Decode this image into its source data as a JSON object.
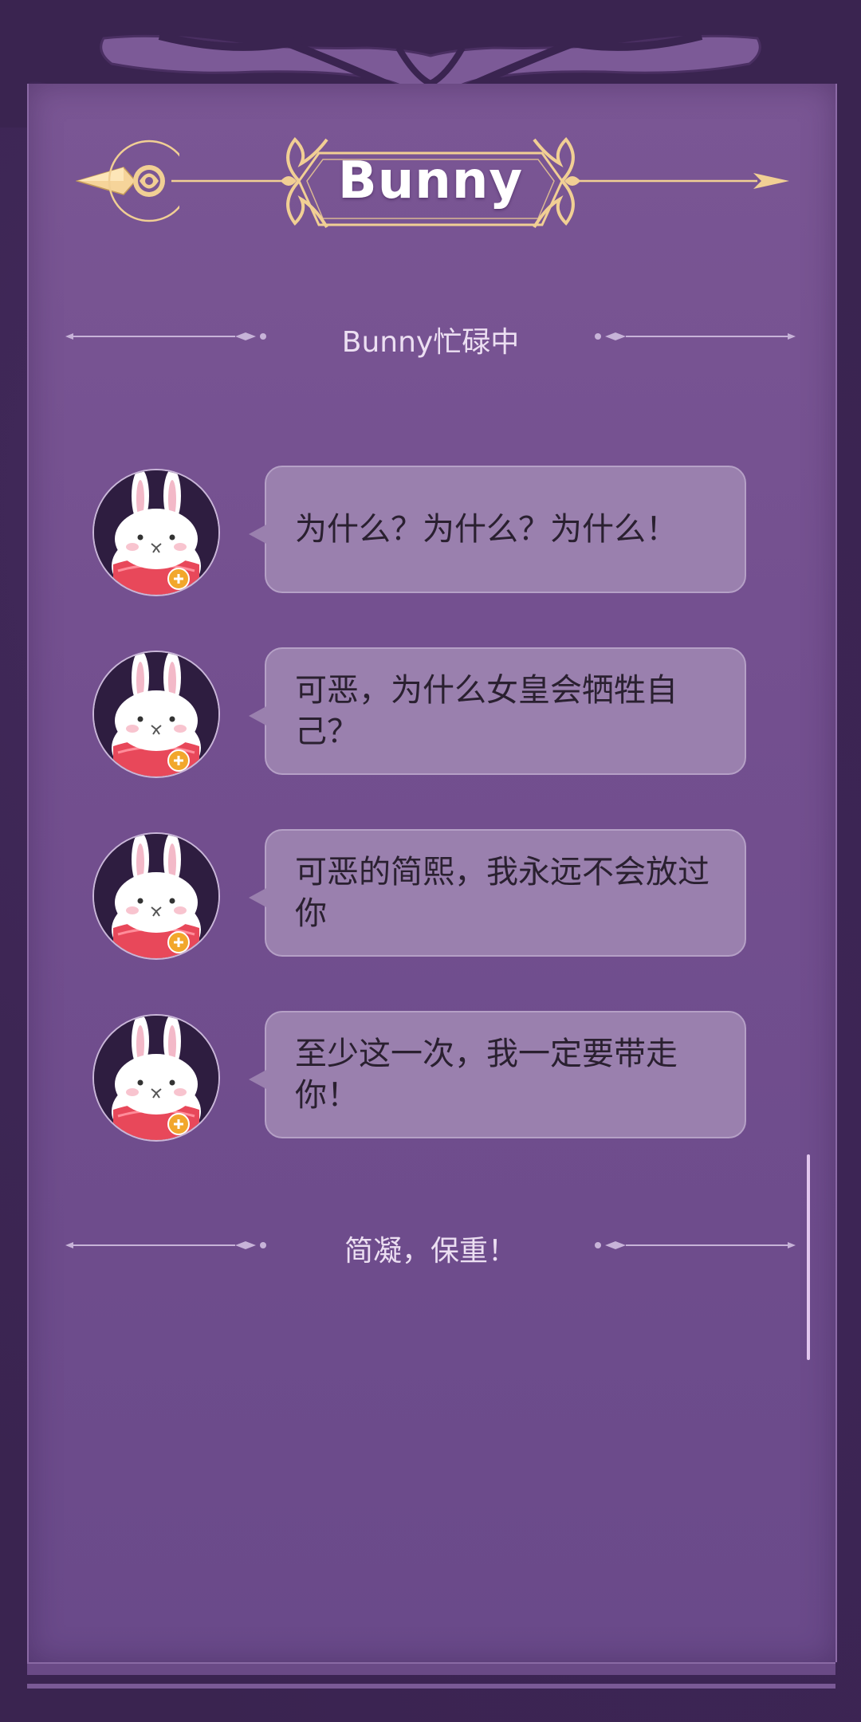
{
  "header": {
    "title": "Bunny"
  },
  "status_divider": {
    "text": "Bunny忙碌中"
  },
  "messages": [
    {
      "speaker": "Bunny",
      "text": "为什么？为什么？为什么！"
    },
    {
      "speaker": "Bunny",
      "text": "可恶，为什么女皇会牺牲自己？"
    },
    {
      "speaker": "Bunny",
      "text": "可恶的简熙，我永远不会放过你"
    },
    {
      "speaker": "Bunny",
      "text": "至少这一次，我一定要带走你！"
    }
  ],
  "footer_divider": {
    "text": "简凝，保重！"
  },
  "colors": {
    "panel": "#734f8f",
    "frame": "#3a2450",
    "gold": "#f1cf94",
    "bubble": "#9a80ae"
  },
  "icons": {
    "back": "arrow-left-icon",
    "avatar": "bunny-avatar-icon"
  }
}
